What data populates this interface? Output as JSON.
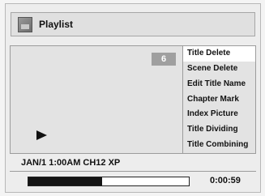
{
  "header": {
    "title": "Playlist",
    "icon": "playlist-icon"
  },
  "preview": {
    "count": "6",
    "play_icon": "play-icon"
  },
  "menu": {
    "items": [
      {
        "label": "Title Delete",
        "selected": true
      },
      {
        "label": "Scene Delete",
        "selected": false
      },
      {
        "label": "Edit Title Name",
        "selected": false
      },
      {
        "label": "Chapter Mark",
        "selected": false
      },
      {
        "label": "Index Picture",
        "selected": false
      },
      {
        "label": "Title Dividing",
        "selected": false
      },
      {
        "label": "Title Combining",
        "selected": false
      }
    ]
  },
  "info": {
    "recording": "JAN/1 1:00AM CH12 XP"
  },
  "progress": {
    "fraction": 0.46,
    "time": "0:00:59"
  },
  "colors": {
    "selected_bg": "#ffffff",
    "panel_bg": "#e3e3e3",
    "progress_fill": "#151515"
  }
}
